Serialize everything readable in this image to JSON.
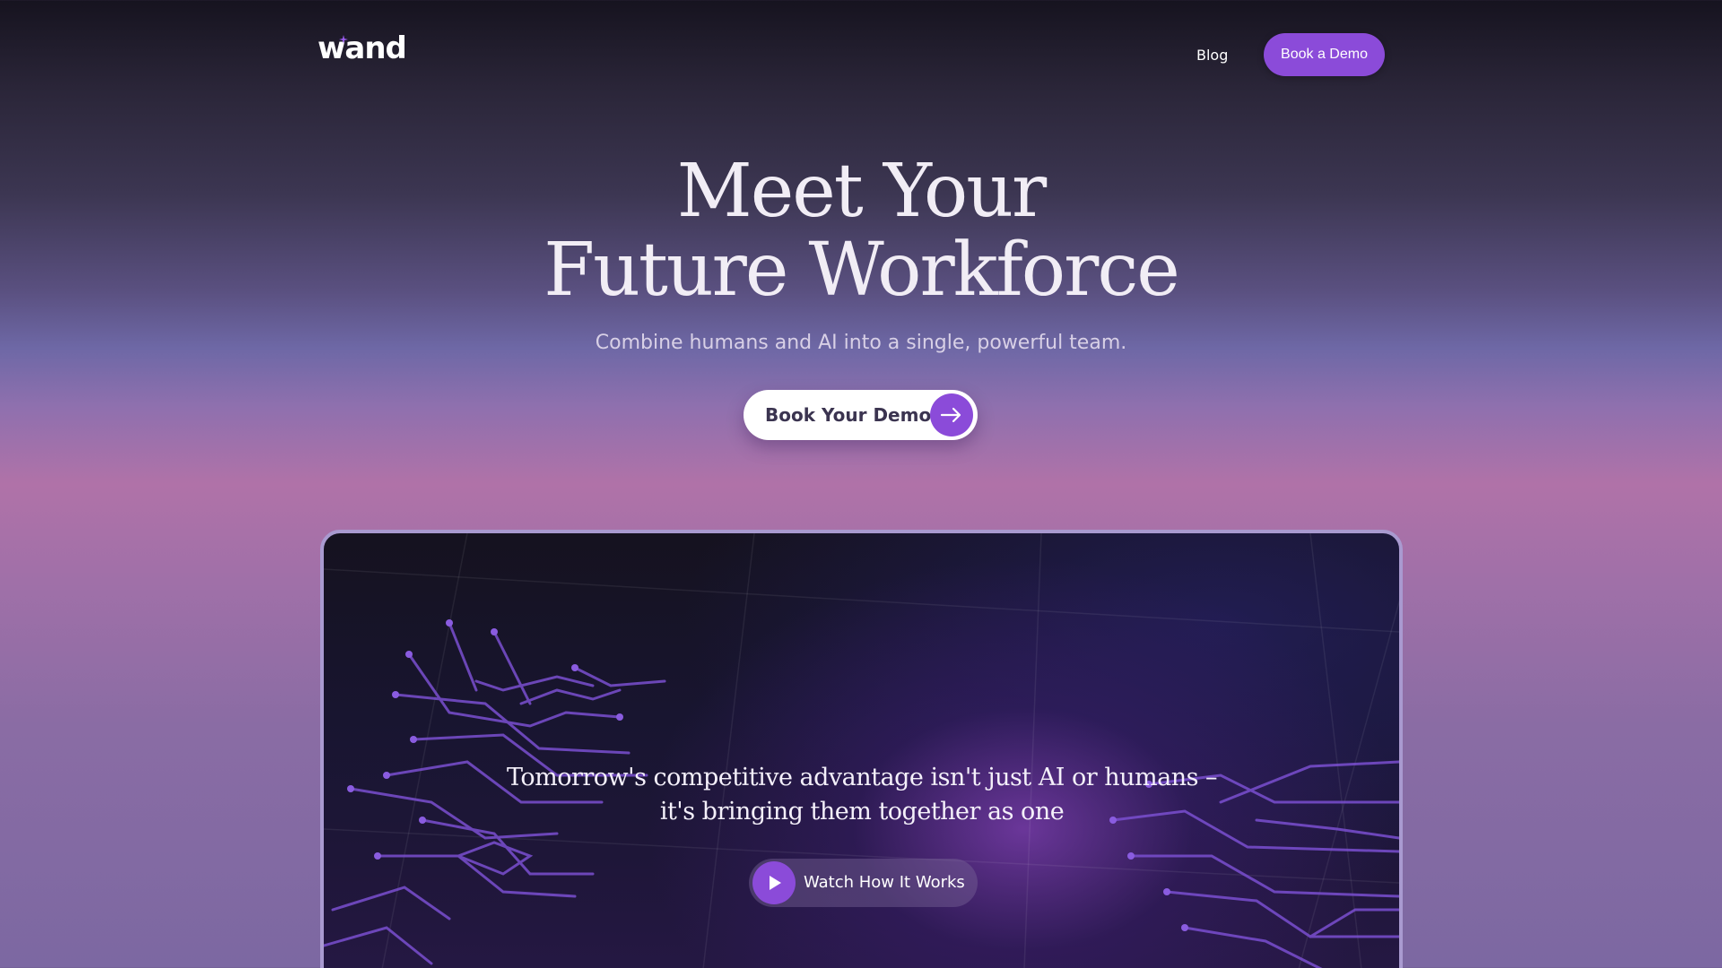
{
  "header": {
    "logo_text": "wand",
    "nav": {
      "blog_label": "Blog",
      "book_demo_label": "Book a Demo"
    }
  },
  "hero": {
    "title_line1": "Meet Your",
    "title_line2": "Future Workforce",
    "subtitle": "Combine humans and AI into a single, powerful team.",
    "cta_label": "Book Your Demo",
    "cta_icon": "arrow-right-icon"
  },
  "video": {
    "quote_line1": "Tomorrow's competitive advantage isn't just AI or humans –",
    "quote_line2": "it's bringing them together as one",
    "watch_label": "Watch How It Works",
    "watch_icon": "play-icon"
  },
  "colors": {
    "accent": "#8b4bd9",
    "card_border": "#a99ad0",
    "circuit": "#7a4fd0"
  }
}
